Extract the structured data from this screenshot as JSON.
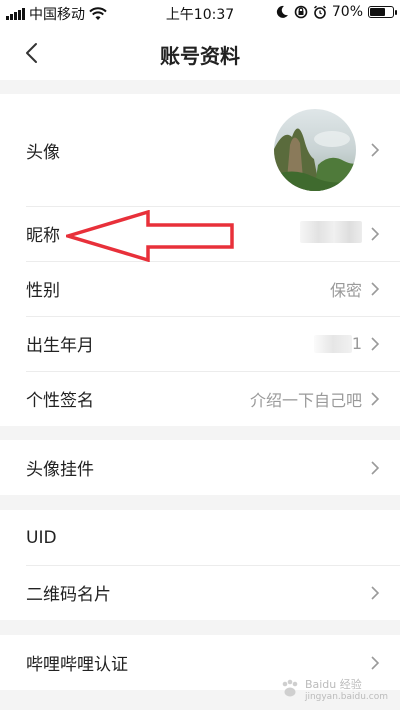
{
  "status_bar": {
    "carrier": "中国移动",
    "time": "上午10:37",
    "battery_percent": "70%",
    "battery_level": 0.7
  },
  "nav": {
    "back_icon": "chevron-left-icon",
    "title": "账号资料"
  },
  "rows": {
    "avatar": {
      "label": "头像"
    },
    "nickname": {
      "label": "昵称"
    },
    "gender": {
      "label": "性别",
      "value": "保密"
    },
    "birthday": {
      "label": "出生年月",
      "value": "1"
    },
    "signature": {
      "label": "个性签名",
      "value": "介绍一下自己吧"
    },
    "pendant": {
      "label": "头像挂件"
    },
    "uid": {
      "label": "UID"
    },
    "qrcode": {
      "label": "二维码名片"
    },
    "verify": {
      "label": "哔哩哔哩认证"
    }
  },
  "colors": {
    "annotation_arrow": "#e8303a",
    "background": "#f4f4f4",
    "chevron": "#9a9a9a"
  },
  "watermark": {
    "text": "Baidu 经验",
    "sub": "jingyan.baidu.com"
  }
}
